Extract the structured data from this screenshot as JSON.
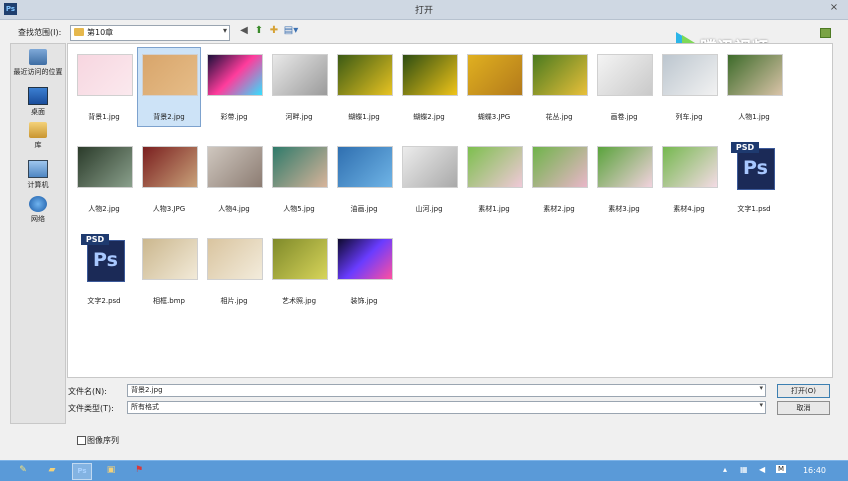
{
  "window": {
    "title": "打开",
    "app_icon": "Ps",
    "close": "×"
  },
  "lookin": {
    "label": "查找范围(I):",
    "value": "第10章"
  },
  "watermark": {
    "text": "腾讯视频"
  },
  "sidebar": [
    {
      "label": "最近访问的位置",
      "icon": "recent-places-icon"
    },
    {
      "label": "桌面",
      "icon": "desktop-icon"
    },
    {
      "label": "库",
      "icon": "libraries-icon"
    },
    {
      "label": "计算机",
      "icon": "computer-icon"
    },
    {
      "label": "网络",
      "icon": "network-icon"
    }
  ],
  "files": [
    {
      "name": "背景1.jpg",
      "type": "image",
      "colors": [
        "#f7d6e0",
        "#fbe9ee"
      ]
    },
    {
      "name": "背景2.jpg",
      "type": "image",
      "colors": [
        "#d8a56b",
        "#e6bd88"
      ],
      "selected": true
    },
    {
      "name": "彩带.jpg",
      "type": "image",
      "colors": [
        "#1a0f3a",
        "#ff3c9c",
        "#33e0ff"
      ]
    },
    {
      "name": "河畔.jpg",
      "type": "image",
      "colors": [
        "#e9e9e9",
        "#9b9b9b"
      ]
    },
    {
      "name": "蝴蝶1.jpg",
      "type": "image",
      "colors": [
        "#3b5a14",
        "#e8c322"
      ]
    },
    {
      "name": "蝴蝶2.jpg",
      "type": "image",
      "colors": [
        "#2d4d12",
        "#f0c419"
      ]
    },
    {
      "name": "蝴蝶3.JPG",
      "type": "image",
      "colors": [
        "#e0b020",
        "#b37a1b"
      ]
    },
    {
      "name": "花丛.jpg",
      "type": "image",
      "colors": [
        "#4a7a1f",
        "#e9c03a"
      ]
    },
    {
      "name": "画卷.jpg",
      "type": "image",
      "colors": [
        "#f4f4f4",
        "#c9c9c9"
      ]
    },
    {
      "name": "列车.jpg",
      "type": "image",
      "colors": [
        "#bcc6cf",
        "#f2f2f2"
      ]
    },
    {
      "name": "人物1.jpg",
      "type": "image",
      "colors": [
        "#3d6b2a",
        "#d9c3a8"
      ]
    },
    {
      "name": "人物2.jpg",
      "type": "image",
      "colors": [
        "#2b3b2a",
        "#8aa08c"
      ]
    },
    {
      "name": "人物3.JPG",
      "type": "image",
      "colors": [
        "#7a1f1f",
        "#c9a27a"
      ]
    },
    {
      "name": "人物4.jpg",
      "type": "image",
      "colors": [
        "#cfc7bf",
        "#8c7c72"
      ]
    },
    {
      "name": "人物5.jpg",
      "type": "image",
      "colors": [
        "#2f7a6a",
        "#d8b49a"
      ]
    },
    {
      "name": "油画.jpg",
      "type": "image",
      "colors": [
        "#2f6fb0",
        "#6fb4e6"
      ]
    },
    {
      "name": "山河.jpg",
      "type": "image",
      "colors": [
        "#ececec",
        "#a9a9a9"
      ]
    },
    {
      "name": "素材1.jpg",
      "type": "image",
      "colors": [
        "#7dbf4e",
        "#f0c9d8"
      ]
    },
    {
      "name": "素材2.jpg",
      "type": "image",
      "colors": [
        "#6fb34a",
        "#e9b6c9"
      ]
    },
    {
      "name": "素材3.jpg",
      "type": "image",
      "colors": [
        "#5aa33c",
        "#f2d2de"
      ]
    },
    {
      "name": "素材4.jpg",
      "type": "image",
      "colors": [
        "#75b84f",
        "#f4dbe5"
      ]
    },
    {
      "name": "文字1.psd",
      "type": "psd"
    },
    {
      "name": "文字2.psd",
      "type": "psd"
    },
    {
      "name": "相框.bmp",
      "type": "image",
      "colors": [
        "#cbb78e",
        "#f2ead8"
      ]
    },
    {
      "name": "相片.jpg",
      "type": "image",
      "colors": [
        "#d9c49f",
        "#f3ecdc"
      ]
    },
    {
      "name": "艺术照.jpg",
      "type": "image",
      "colors": [
        "#7f8a2a",
        "#d7d45a"
      ]
    },
    {
      "name": "装饰.jpg",
      "type": "image",
      "colors": [
        "#0e0a2e",
        "#6a3cff",
        "#ff4fa0"
      ]
    }
  ],
  "psd_tag": "PSD",
  "psd_glyph": "Ps",
  "filename": {
    "label": "文件名(N):",
    "value": "背景2.jpg"
  },
  "filetype": {
    "label": "文件类型(T):",
    "value": "所有格式"
  },
  "buttons": {
    "open": "打开(O)",
    "cancel": "取消"
  },
  "image_sequence": {
    "label": "图像序列",
    "checked": false
  },
  "taskbar": {
    "items": [
      "pencil-icon",
      "folder-icon",
      "photoshop-icon",
      "explorer-icon",
      "flag-icon"
    ],
    "ps_label": "Ps",
    "tray_ime": "M",
    "clock": "16:40"
  }
}
